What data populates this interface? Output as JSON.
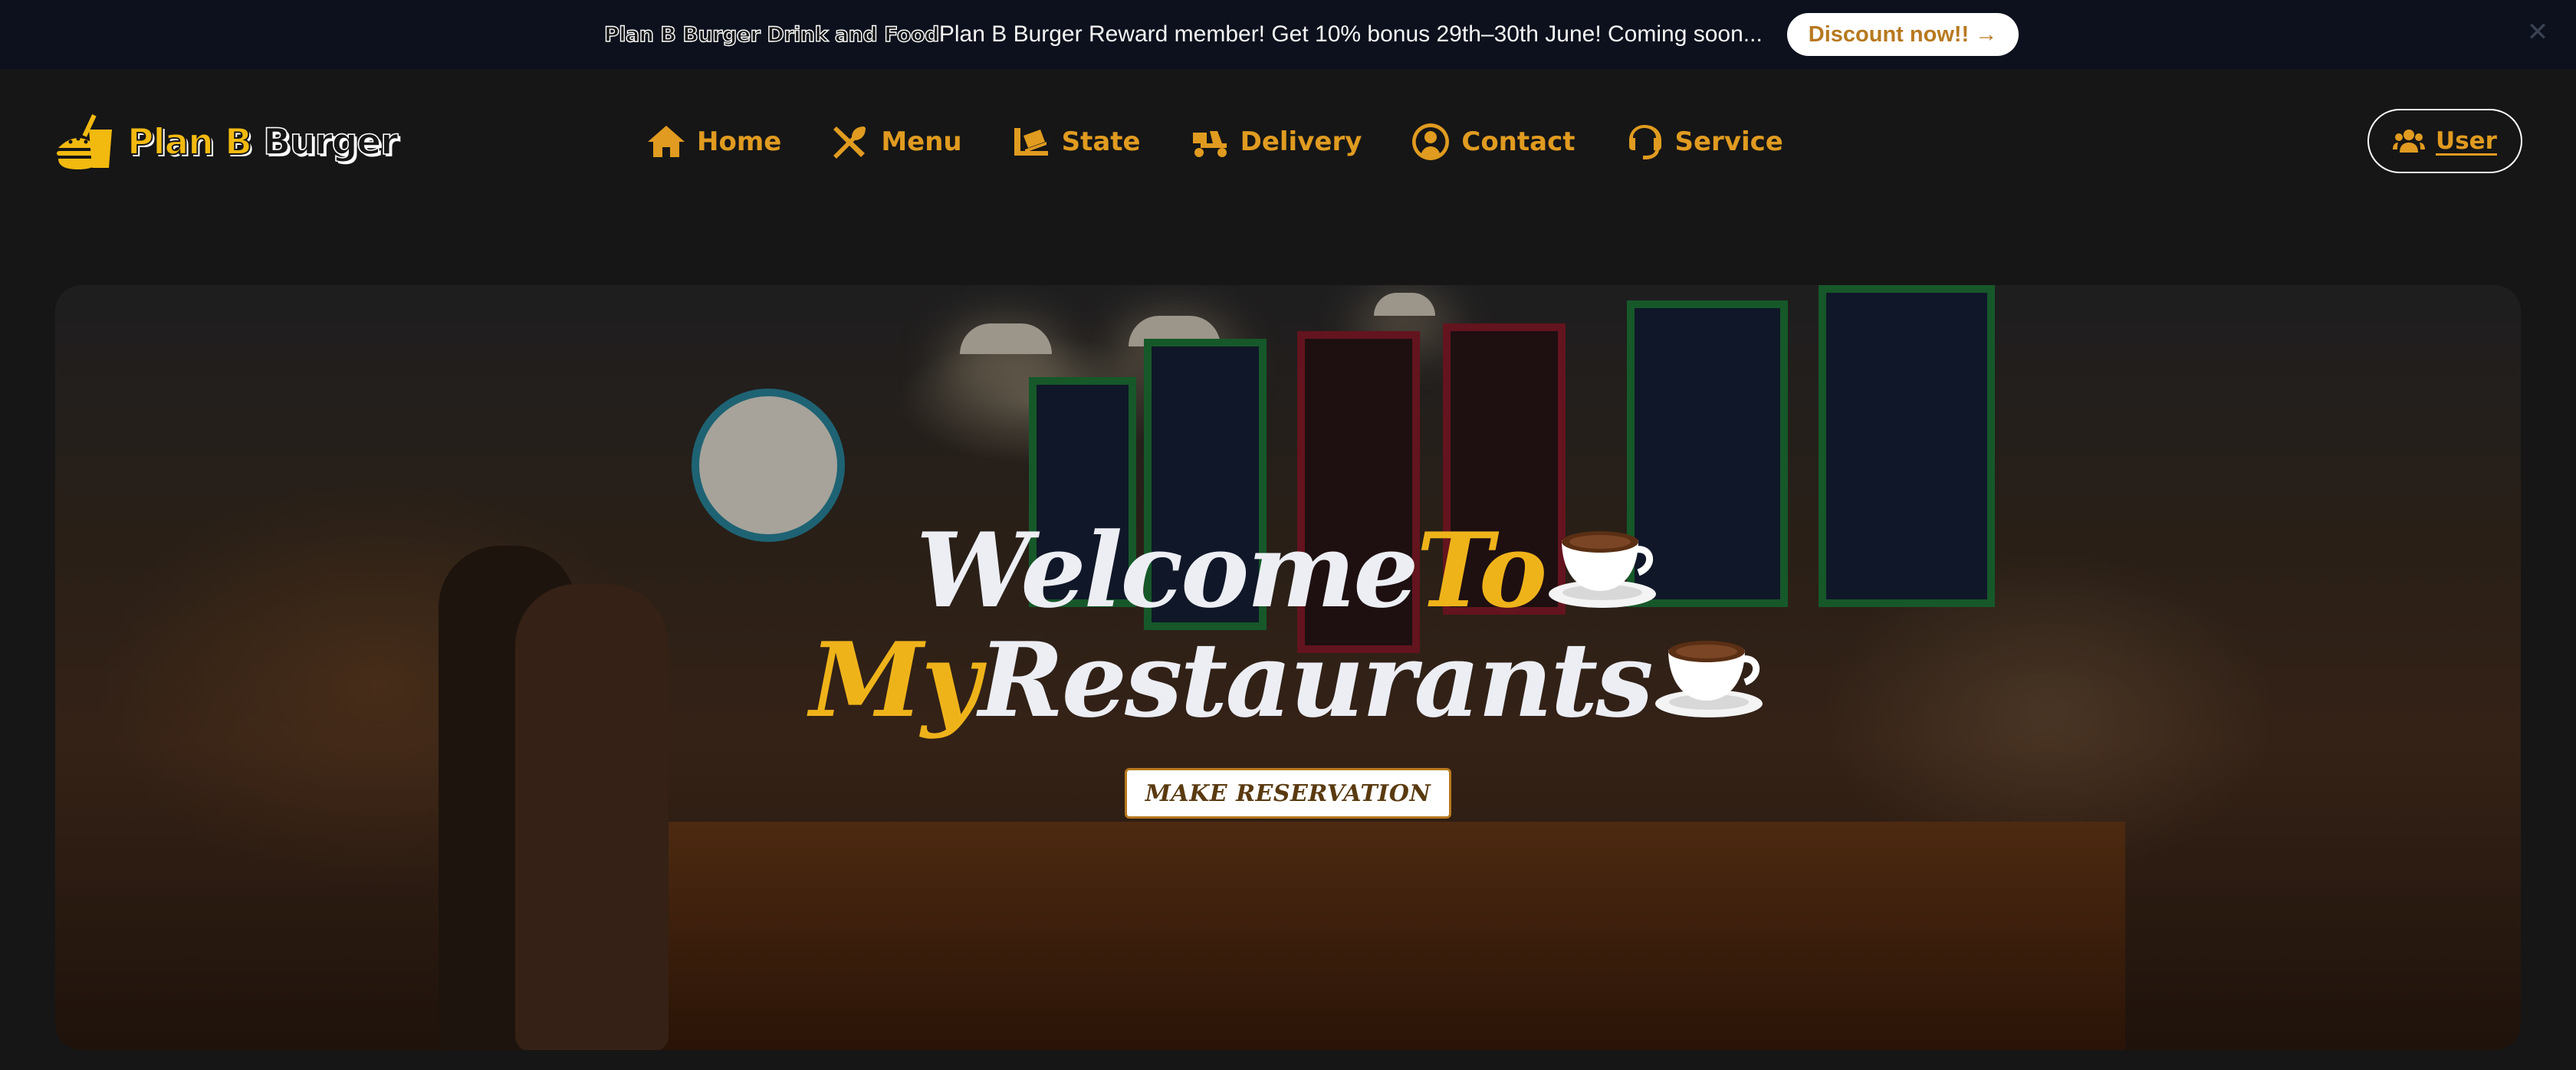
{
  "announcement": {
    "brand": "Plan B Burger Drink and Food",
    "message": "Plan B Burger Reward member! Get 10% bonus 29th–30th June! Coming soon...",
    "cta": "Discount now!! →",
    "close": "✕"
  },
  "logo": {
    "part1": "Plan B",
    "part2": "Burger"
  },
  "nav": [
    {
      "label": "Home",
      "icon": "home-icon"
    },
    {
      "label": "Menu",
      "icon": "utensils-icon"
    },
    {
      "label": "State",
      "icon": "truck-ramp-icon"
    },
    {
      "label": "Delivery",
      "icon": "moped-icon"
    },
    {
      "label": "Contact",
      "icon": "user-circle-icon"
    },
    {
      "label": "Service",
      "icon": "headset-icon"
    }
  ],
  "user": {
    "label": "User",
    "icon": "users-icon"
  },
  "hero": {
    "line1_a": "Welcome",
    "line1_b": "To",
    "line2_a": "My",
    "line2_b": "Restaurants",
    "cta": "MAKE RESERVATION"
  },
  "colors": {
    "accent": "#e09b20",
    "title_accent": "#efb31a",
    "background": "#161616",
    "topbar": "#0c111d"
  }
}
